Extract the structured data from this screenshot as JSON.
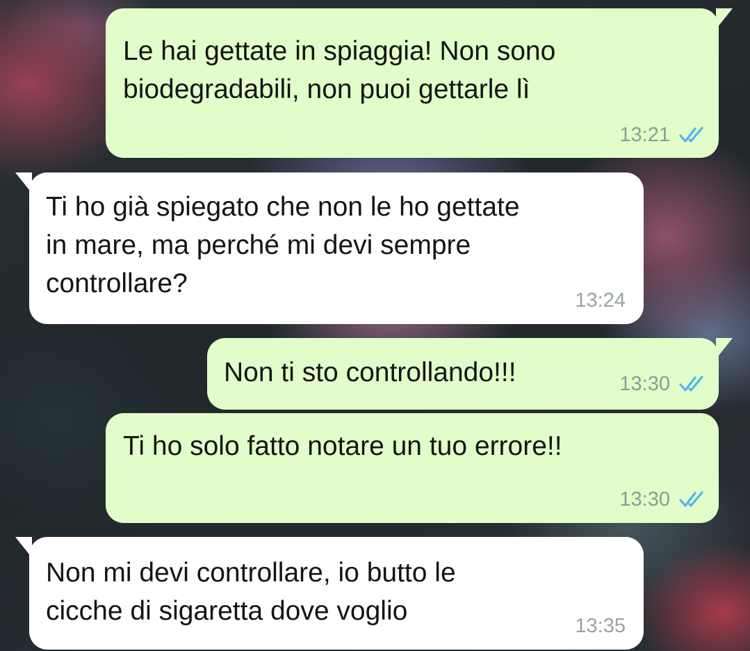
{
  "colors": {
    "outgoing_bubble": "#e2fdc9",
    "incoming_bubble": "#ffffff",
    "read_tick": "#4fb6ec",
    "timestamp": "#8f9a93"
  },
  "messages": [
    {
      "direction": "outgoing",
      "text": "Le hai gettate in spiaggia! Non sono\nbiodegradabili, non puoi gettarle lì",
      "time": "13:21",
      "status_icon": "double-check-read-icon"
    },
    {
      "direction": "incoming",
      "text": "Ti ho già spiegato che non le ho gettate\nin mare, ma perché mi devi sempre\ncontrollare?",
      "time": "13:24"
    },
    {
      "direction": "outgoing",
      "text": "Non ti sto controllando!!!",
      "time": "13:30",
      "status_icon": "double-check-read-icon"
    },
    {
      "direction": "outgoing",
      "text": "Ti ho solo fatto notare un tuo errore!!",
      "time": "13:30",
      "status_icon": "double-check-read-icon"
    },
    {
      "direction": "incoming",
      "text": "Non mi devi controllare, io butto le\ncicche di sigaretta dove voglio",
      "time": "13:35"
    }
  ]
}
